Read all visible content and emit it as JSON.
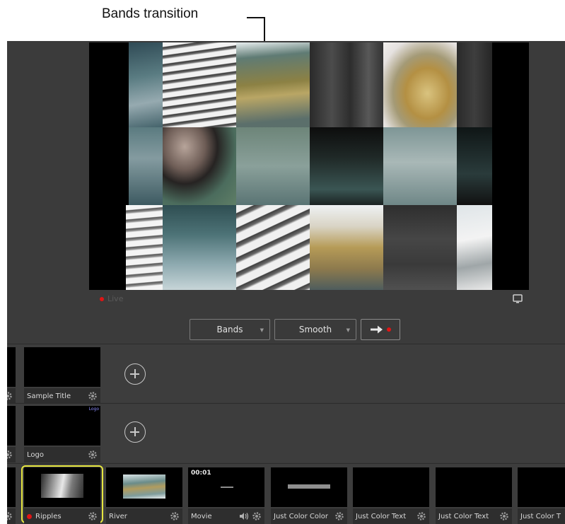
{
  "callout": {
    "label": "Bands transition"
  },
  "preview": {
    "live_label": "Live",
    "monitor_icon": "monitor-icon"
  },
  "transition": {
    "type": "Bands",
    "easing": "Smooth",
    "go_icon": "arrow-right-icon"
  },
  "titles_row": {
    "items": [
      {
        "label": "Sample Title",
        "thumb_text": ""
      }
    ]
  },
  "overlays_row": {
    "items": [
      {
        "label": "Logo",
        "thumb_text": "Logo"
      }
    ]
  },
  "sources_row": {
    "items": [
      {
        "label": "Ripples",
        "live": true
      },
      {
        "label": "River"
      },
      {
        "label": "Movie",
        "thumb_text": "00:01",
        "has_volume": true
      },
      {
        "label": "Just Color Color"
      },
      {
        "label": "Just Color Text"
      },
      {
        "label": "Just Color Text"
      },
      {
        "label": "Just Color T"
      }
    ]
  },
  "colors": {
    "accent_selected": "#e6e640",
    "live_red": "#e01515",
    "panel_bg": "#3b3b3b"
  }
}
